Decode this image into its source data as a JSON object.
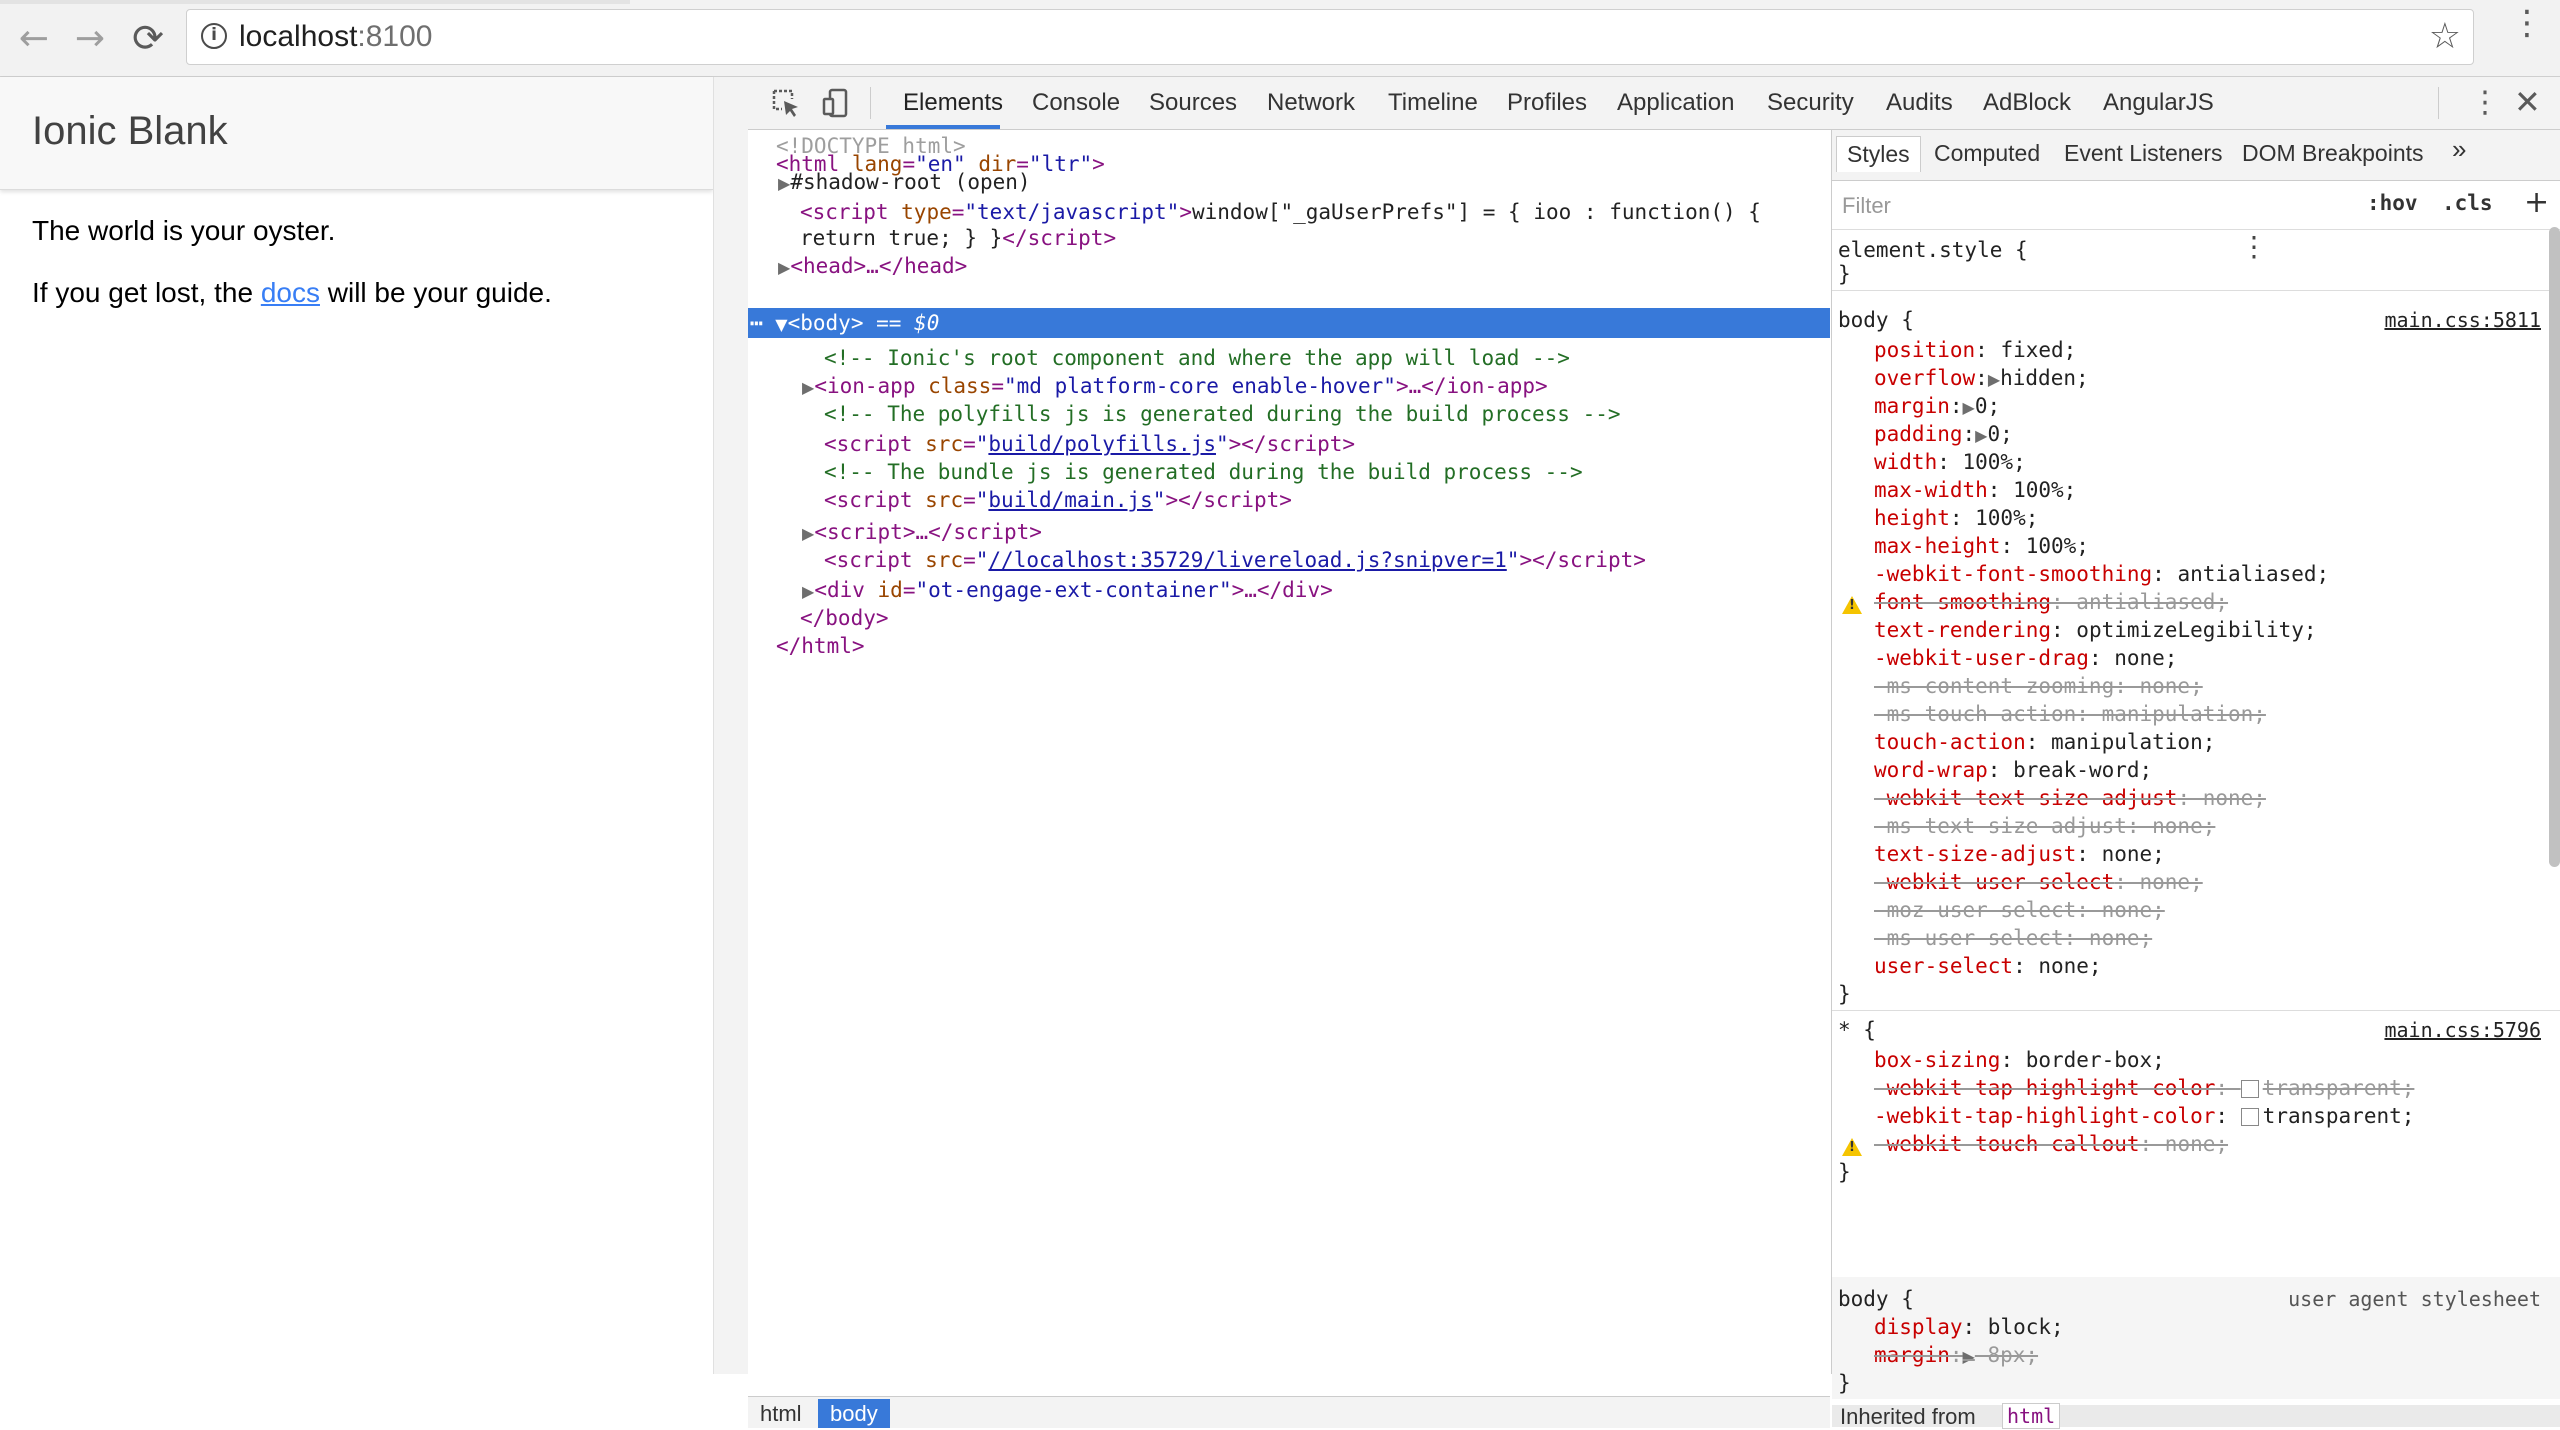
{
  "browser": {
    "url_host": "localhost",
    "url_port": ":8100",
    "back_glyph": "←",
    "forward_glyph": "→",
    "reload_glyph": "⟳",
    "info_glyph": "i",
    "star_glyph": "☆",
    "menu_glyph": "⋮"
  },
  "page": {
    "title": "Ionic Blank",
    "line1": "The world is your oyster.",
    "line2_pre": "If you get lost, the ",
    "line2_link": "docs",
    "line2_post": " will be your guide."
  },
  "devtools": {
    "tabs": [
      "Elements",
      "Console",
      "Sources",
      "Network",
      "Timeline",
      "Profiles",
      "Application",
      "Security",
      "Audits",
      "AdBlock",
      "AngularJS"
    ],
    "more_glyph": "⋮",
    "close_glyph": "✕"
  },
  "dom": {
    "doctype": "<!DOCTYPE html>",
    "html_open": "<html lang=\"en\" dir=\"ltr\">",
    "shadow": "#shadow-root (open)",
    "script1a": "window[\"_gaUserPrefs\"] = { ioo : function() {",
    "script1b": "return true; } }",
    "head": "<head>…</head>",
    "body_sel": "== $0",
    "cmt1": "<!-- Ionic's root component and where the app will load -->",
    "ionapp_class": "md platform-core enable-hover",
    "cmt2": "<!-- The polyfills js is generated during the build process -->",
    "src_polyfills": "build/polyfills.js",
    "cmt3": "<!-- The bundle js is generated during the build process -->",
    "src_main": "build/main.js",
    "src_livereload": "//localhost:35729/livereload.js?snipver=1",
    "div_id": "ot-engage-ext-container"
  },
  "breadcrumbs": [
    "html",
    "body"
  ],
  "styles": {
    "tabs": [
      "Styles",
      "Computed",
      "Event Listeners",
      "DOM Breakpoints"
    ],
    "more": "»",
    "filter_placeholder": "Filter",
    "hov": ":hov",
    "cls": ".cls",
    "add": "+",
    "element_style": "element.style {",
    "body_selector": "body {",
    "body_source": "main.css:5811",
    "star_selector": "* {",
    "star_source": "main.css:5796",
    "ua_selector": "body {",
    "ua_source": "user agent stylesheet",
    "inherited_label": "Inherited from",
    "inherited_tag": "html"
  }
}
